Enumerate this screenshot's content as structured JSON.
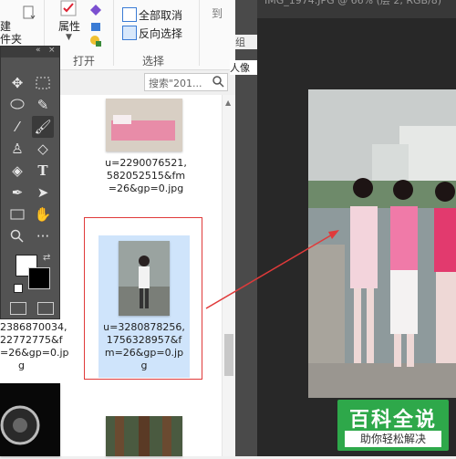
{
  "ribbon": {
    "left_partial_lines": [
      "建",
      "件夹"
    ],
    "properties_label": "属性",
    "open_group_label": "打开",
    "select_all_none_label": "全部取消",
    "invert_selection_label": "反向选择",
    "select_group_label": "选择",
    "tab_partial": "到",
    "group_partial": "组"
  },
  "search": {
    "placeholder": "搜索\"201..."
  },
  "files": [
    {
      "caption_lines": [
        "u=2290076521,",
        "582052515&fm",
        "=26&gp=0.jpg"
      ]
    },
    {
      "caption_lines": [
        "u=3280878256,",
        "1756328957&f",
        "m=26&gp=0.jp",
        "g"
      ]
    },
    {
      "caption_lines": [
        "2386870034,",
        "22772775&f",
        "=26&gp=0.jp",
        "g"
      ]
    }
  ],
  "ps": {
    "doc_tab_partial": "IMG_1974.JPG @ 66% (层 2, RGB/8)",
    "side_label": "人像"
  },
  "watermark": {
    "title": "百科全说",
    "subtitle": "助你轻松解决"
  },
  "colors": {
    "selection_border": "#e03a3a",
    "arrow": "#e03a3a",
    "ps_panel": "#535353",
    "watermark_bg": "#2ea84a"
  }
}
